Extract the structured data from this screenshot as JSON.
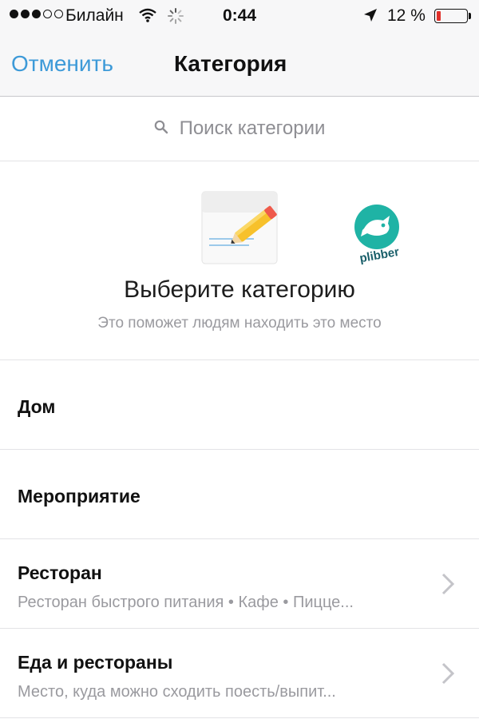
{
  "status_bar": {
    "carrier": "Билайн",
    "time": "0:44",
    "battery_percent": "12 %",
    "battery_level": 0.12,
    "icons": [
      "signal-dots",
      "wifi-icon",
      "activity-spinner-icon",
      "location-arrow-icon",
      "battery-icon"
    ]
  },
  "nav": {
    "cancel_label": "Отменить",
    "title": "Категория"
  },
  "search": {
    "placeholder": "Поиск категории",
    "icon": "search-icon"
  },
  "hero": {
    "title": "Выберите категорию",
    "subtitle": "Это поможет людям находить это место",
    "illustration": "pencil-notepad-icon",
    "watermark": "plibber"
  },
  "categories": [
    {
      "title": "Дом",
      "subtitle": ""
    },
    {
      "title": "Мероприятие",
      "subtitle": ""
    },
    {
      "title": "Ресторан",
      "subtitle": "Ресторан быстрого питания • Кафе • Пицце..."
    },
    {
      "title": "Еда и рестораны",
      "subtitle": "Место, куда можно сходить поесть/выпит..."
    }
  ],
  "colors": {
    "accent": "#3d9ad8",
    "battery_low": "#e0302a",
    "secondary_text": "#9a9a9f",
    "logo": "#1fb3a5"
  }
}
